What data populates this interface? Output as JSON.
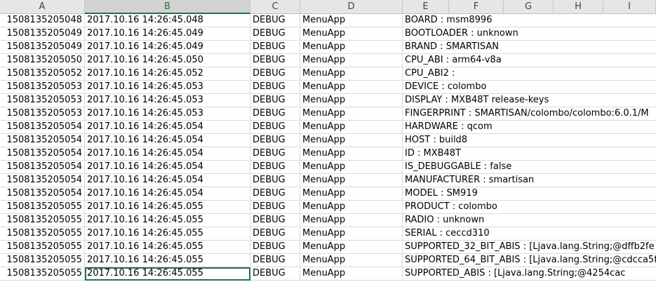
{
  "columns": [
    "A",
    "B",
    "C",
    "D",
    "E",
    "F",
    "G",
    "H",
    "I"
  ],
  "selected_column": "B",
  "active_cell": "B20",
  "rows": [
    {
      "a": "1508135205048",
      "b": "2017.10.16 14:26:45.048",
      "c": "DEBUG",
      "d": "MenuApp",
      "e": "BOARD : msm8996"
    },
    {
      "a": "1508135205049",
      "b": "2017.10.16 14:26:45.049",
      "c": "DEBUG",
      "d": "MenuApp",
      "e": "BOOTLOADER : unknown"
    },
    {
      "a": "1508135205049",
      "b": "2017.10.16 14:26:45.049",
      "c": "DEBUG",
      "d": "MenuApp",
      "e": "BRAND : SMARTISAN"
    },
    {
      "a": "1508135205050",
      "b": "2017.10.16 14:26:45.050",
      "c": "DEBUG",
      "d": "MenuApp",
      "e": "CPU_ABI : arm64-v8a"
    },
    {
      "a": "1508135205052",
      "b": "2017.10.16 14:26:45.052",
      "c": "DEBUG",
      "d": "MenuApp",
      "e": "CPU_ABI2 :"
    },
    {
      "a": "1508135205053",
      "b": "2017.10.16 14:26:45.053",
      "c": "DEBUG",
      "d": "MenuApp",
      "e": "DEVICE : colombo"
    },
    {
      "a": "1508135205053",
      "b": "2017.10.16 14:26:45.053",
      "c": "DEBUG",
      "d": "MenuApp",
      "e": "DISPLAY : MXB48T release-keys"
    },
    {
      "a": "1508135205053",
      "b": "2017.10.16 14:26:45.053",
      "c": "DEBUG",
      "d": "MenuApp",
      "e": "FINGERPRINT : SMARTISAN/colombo/colombo:6.0.1/M"
    },
    {
      "a": "1508135205054",
      "b": "2017.10.16 14:26:45.054",
      "c": "DEBUG",
      "d": "MenuApp",
      "e": "HARDWARE : qcom"
    },
    {
      "a": "1508135205054",
      "b": "2017.10.16 14:26:45.054",
      "c": "DEBUG",
      "d": "MenuApp",
      "e": "HOST : build8"
    },
    {
      "a": "1508135205054",
      "b": "2017.10.16 14:26:45.054",
      "c": "DEBUG",
      "d": "MenuApp",
      "e": "ID : MXB48T"
    },
    {
      "a": "1508135205054",
      "b": "2017.10.16 14:26:45.054",
      "c": "DEBUG",
      "d": "MenuApp",
      "e": "IS_DEBUGGABLE : false"
    },
    {
      "a": "1508135205054",
      "b": "2017.10.16 14:26:45.054",
      "c": "DEBUG",
      "d": "MenuApp",
      "e": "MANUFACTURER : smartisan"
    },
    {
      "a": "1508135205054",
      "b": "2017.10.16 14:26:45.054",
      "c": "DEBUG",
      "d": "MenuApp",
      "e": "MODEL : SM919"
    },
    {
      "a": "1508135205055",
      "b": "2017.10.16 14:26:45.055",
      "c": "DEBUG",
      "d": "MenuApp",
      "e": "PRODUCT : colombo"
    },
    {
      "a": "1508135205055",
      "b": "2017.10.16 14:26:45.055",
      "c": "DEBUG",
      "d": "MenuApp",
      "e": "RADIO : unknown"
    },
    {
      "a": "1508135205055",
      "b": "2017.10.16 14:26:45.055",
      "c": "DEBUG",
      "d": "MenuApp",
      "e": "SERIAL : ceccd310"
    },
    {
      "a": "1508135205055",
      "b": "2017.10.16 14:26:45.055",
      "c": "DEBUG",
      "d": "MenuApp",
      "e": "SUPPORTED_32_BIT_ABIS : [Ljava.lang.String;@dffb2fe"
    },
    {
      "a": "1508135205055",
      "b": "2017.10.16 14:26:45.055",
      "c": "DEBUG",
      "d": "MenuApp",
      "e": "SUPPORTED_64_BIT_ABIS : [Ljava.lang.String;@cdcca5f"
    },
    {
      "a": "1508135205055",
      "b": "2017.10.16 14:26:45.055",
      "c": "DEBUG",
      "d": "MenuApp",
      "e": "SUPPORTED_ABIS : [Ljava.lang.String;@4254cac"
    }
  ],
  "colors": {
    "selection": "#217346",
    "grid": "#dadada",
    "header_bg": "#e6e6e6"
  }
}
